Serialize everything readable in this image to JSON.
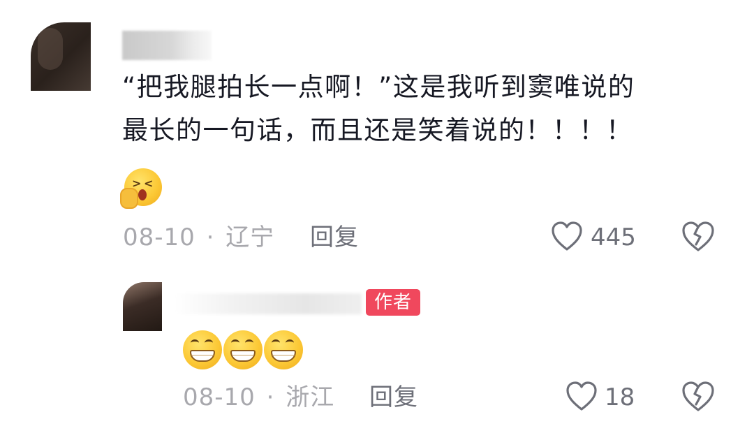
{
  "comment": {
    "text_line1": "“把我腿拍长一点啊！”这是我听到窦唯说的",
    "text_line2": "最长的一句话，而且还是笑着说的！！！！",
    "date": "08-10",
    "separator": "·",
    "location": "辽宁",
    "reply_label": "回复",
    "like_count": "445",
    "emoji": "shocked-hand-over-mouth"
  },
  "reply": {
    "author_badge": "作者",
    "emojis": [
      "grin",
      "grin",
      "grin"
    ],
    "date": "08-10",
    "separator": "·",
    "location": "浙江",
    "reply_label": "回复",
    "like_count": "18"
  },
  "icons": {
    "like": "heart-outline-icon",
    "dislike": "broken-heart-icon"
  },
  "colors": {
    "text": "#161823",
    "meta": "#a8a8ad",
    "action": "#6d6f78",
    "author_badge_bg": "#f0485d"
  }
}
